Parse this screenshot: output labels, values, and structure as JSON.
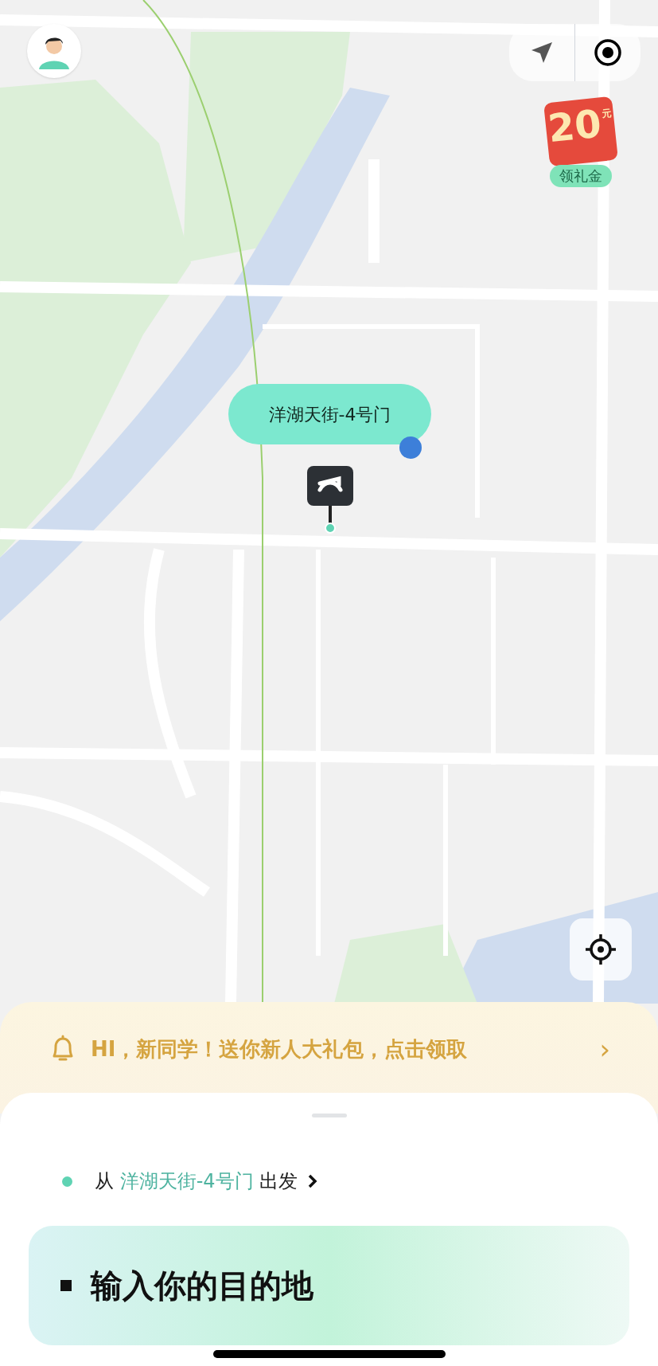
{
  "map": {
    "pickup_label": "洋湖天街-4号门"
  },
  "reward_badge": {
    "amount": "20",
    "unit": "元",
    "action": "领礼金"
  },
  "promo_banner": {
    "text": "HI，新同学！送你新人大礼包，点击领取",
    "chevron": "›"
  },
  "start": {
    "prefix": "从",
    "place": "洋湖天街-4号门",
    "suffix": "出发"
  },
  "destination": {
    "label": "输入你的目的地"
  }
}
